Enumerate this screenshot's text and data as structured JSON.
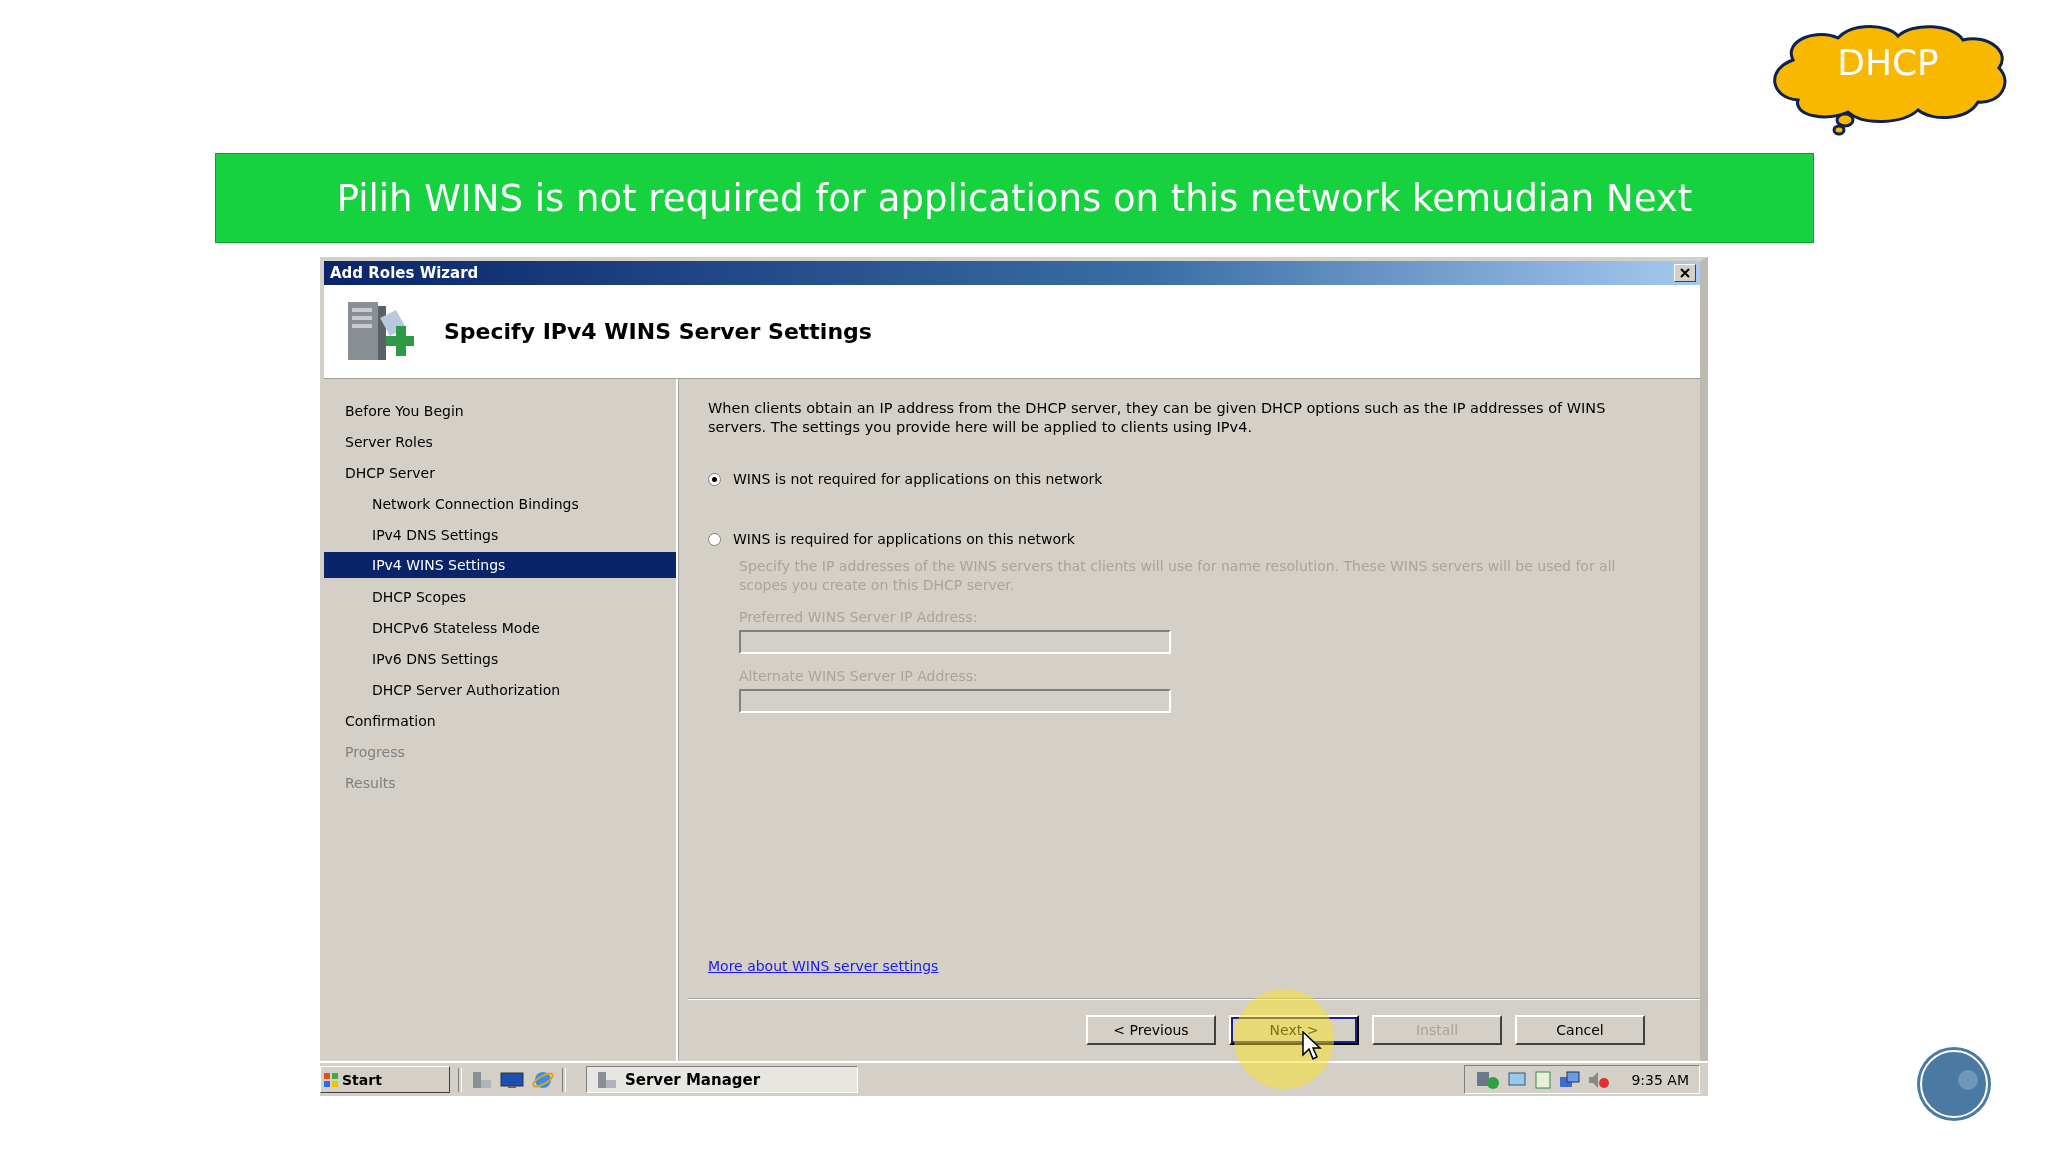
{
  "slide": {
    "banner": "Pilih WINS is not required for applications on this network kemudian Next",
    "cloud_label": "DHCP"
  },
  "window": {
    "title": "Add Roles Wizard",
    "heading": "Specify IPv4 WINS Server Settings"
  },
  "nav": {
    "items": [
      {
        "label": "Before You Begin",
        "selected": false,
        "disabled": false
      },
      {
        "label": "Server Roles",
        "selected": false,
        "disabled": false
      },
      {
        "label": "DHCP Server",
        "selected": false,
        "disabled": false,
        "children": [
          {
            "label": "Network Connection Bindings",
            "selected": false,
            "disabled": false
          },
          {
            "label": "IPv4 DNS Settings",
            "selected": false,
            "disabled": false
          },
          {
            "label": "IPv4 WINS Settings",
            "selected": true,
            "disabled": false
          },
          {
            "label": "DHCP Scopes",
            "selected": false,
            "disabled": false
          },
          {
            "label": "DHCPv6 Stateless Mode",
            "selected": false,
            "disabled": false
          },
          {
            "label": "IPv6 DNS Settings",
            "selected": false,
            "disabled": false
          },
          {
            "label": "DHCP Server Authorization",
            "selected": false,
            "disabled": false
          }
        ]
      },
      {
        "label": "Confirmation",
        "selected": false,
        "disabled": false
      },
      {
        "label": "Progress",
        "selected": false,
        "disabled": true
      },
      {
        "label": "Results",
        "selected": false,
        "disabled": true
      }
    ]
  },
  "content": {
    "description": "When clients obtain an IP address from the DHCP server, they can be given DHCP options such as the IP addresses of WINS servers. The settings you provide here will be applied to clients using IPv4.",
    "options": [
      {
        "label": "WINS is not required for applications on this network",
        "selected": true
      },
      {
        "label": "WINS is required for applications on this network",
        "selected": false
      }
    ],
    "wins_servers": {
      "disabled": true,
      "description": "Specify the IP addresses of the WINS servers that clients will use for name resolution. These WINS servers will be used for all scopes you create on this DHCP server.",
      "fields": [
        {
          "label": "Preferred WINS Server IP Address:"
        },
        {
          "label": "Alternate WINS Server IP Address:"
        }
      ]
    },
    "link": "More about WINS server settings"
  },
  "buttons": [
    {
      "label": "< Previous",
      "disabled": false,
      "default": false
    },
    {
      "label": "Next >",
      "disabled": false,
      "default": true
    },
    {
      "label": "Install",
      "disabled": true,
      "default": false
    },
    {
      "label": "Cancel",
      "disabled": false,
      "default": false
    }
  ],
  "taskbar": {
    "start": "Start",
    "task": "Server Manager",
    "clock": "9:35 AM"
  }
}
